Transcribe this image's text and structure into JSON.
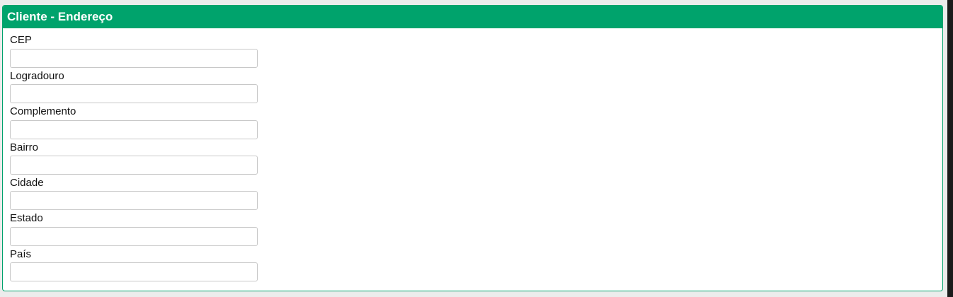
{
  "panel": {
    "title": "Cliente - Endereço"
  },
  "fields": [
    {
      "label": "CEP",
      "value": ""
    },
    {
      "label": "Logradouro",
      "value": ""
    },
    {
      "label": "Complemento",
      "value": ""
    },
    {
      "label": "Bairro",
      "value": ""
    },
    {
      "label": "Cidade",
      "value": ""
    },
    {
      "label": "Estado",
      "value": ""
    },
    {
      "label": "País",
      "value": ""
    }
  ]
}
